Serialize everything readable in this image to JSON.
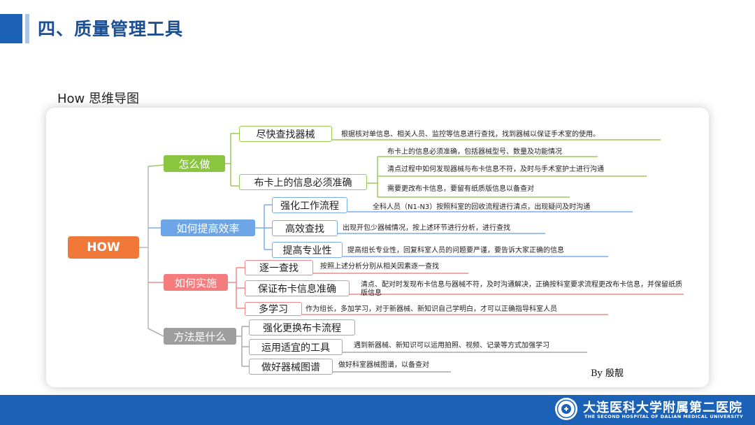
{
  "header": {
    "title": "四、质量管理工具"
  },
  "subtitle": "How 思维导图",
  "mindmap": {
    "root": "HOW",
    "branches": [
      {
        "label": "怎么做",
        "children": [
          {
            "label": "尽快查找器械",
            "notes": [
              "根据核对单信息、相关人员、监控等信息进行查找，找到器械以保证手术室的使用。"
            ]
          },
          {
            "label": "布卡上的信息必须准确",
            "notes": [
              "布卡上的信息必须准确，包括器械型号、数量及功能情况",
              "清点过程中如何发现器械与布卡信息不符，及时与手术室护士进行沟通",
              "需要更改布卡信息，要留有纸质版信息以备查对"
            ]
          }
        ]
      },
      {
        "label": "如何提高效率",
        "children": [
          {
            "label": "强化工作流程",
            "notes": [
              "全科人员（N1-N3）按照科室的回收流程进行清点，出现疑问及时沟通"
            ]
          },
          {
            "label": "高效查找",
            "notes": [
              "出现开包少器械情况，按上述环节进行分析，进行查找"
            ]
          },
          {
            "label": "提高专业性",
            "notes": [
              "提高组长专业性，回复科室人员的问题要严谨，要告诉大家正确的信息"
            ]
          }
        ]
      },
      {
        "label": "如何实施",
        "children": [
          {
            "label": "逐一查找",
            "notes": [
              "按照上述分析分别从相关因素逐一查找"
            ]
          },
          {
            "label": "保证布卡信息准确",
            "notes": [
              "清点、配对时发现布卡信息与器械不符，及时沟通解决，正确按科室要求流程更改布卡信息，并保留纸质版信息"
            ]
          },
          {
            "label": "多学习",
            "notes": [
              "作为组长，多加学习，对于新器械、新知识自己学明白，才可以正确指导科室人员"
            ]
          }
        ]
      },
      {
        "label": "方法是什么",
        "children": [
          {
            "label": "强化更换布卡流程",
            "notes": []
          },
          {
            "label": "运用适宜的工具",
            "notes": [
              "遇到新器械、新知识可以运用拍照、视频、记录等方式加强学习"
            ]
          },
          {
            "label": "做好器械图谱",
            "notes": [
              "做好科室器械图谱，以备查对"
            ]
          }
        ]
      }
    ],
    "byline": "By 殷靓"
  },
  "footer": {
    "school_cn": "大连医科大学附属第二医院",
    "school_en": "THE SECOND HOSPITAL OF DALIAN MEDICAL UNIVERSITY",
    "logo_icon": "hospital-seal-icon"
  },
  "colors": {
    "accent": "#1b62b7",
    "root": "#f07838",
    "green": "#8bc53f",
    "blue": "#6ea5e6",
    "red": "#f47c7c",
    "gray": "#9e9e9e"
  }
}
